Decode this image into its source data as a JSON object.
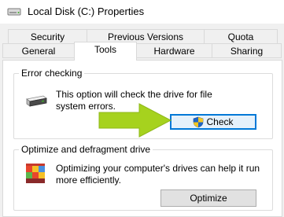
{
  "window": {
    "title": "Local Disk (C:) Properties"
  },
  "tabs": {
    "row_top": [
      {
        "label": "Security"
      },
      {
        "label": "Previous Versions"
      },
      {
        "label": "Quota"
      }
    ],
    "row_bottom": [
      {
        "label": "General"
      },
      {
        "label": "Tools",
        "active": true
      },
      {
        "label": "Hardware"
      },
      {
        "label": "Sharing"
      }
    ]
  },
  "error_checking": {
    "group_label": "Error checking",
    "description_line1": "This option will check the drive for file",
    "description_line2": "system errors.",
    "button_label": "Check",
    "icon": "drive-icon",
    "button_icon": "uac-shield-icon"
  },
  "optimize": {
    "group_label": "Optimize and defragment drive",
    "description_line1": "Optimizing your computer's drives can help it run",
    "description_line2": "more efficiently.",
    "button_label": "Optimize",
    "icon": "defrag-icon"
  },
  "annotation": {
    "icon": "green-arrow",
    "color": "#a6d21e"
  },
  "colors": {
    "focus_accent": "#0078d7",
    "arrow_green": "#a6d21e"
  }
}
